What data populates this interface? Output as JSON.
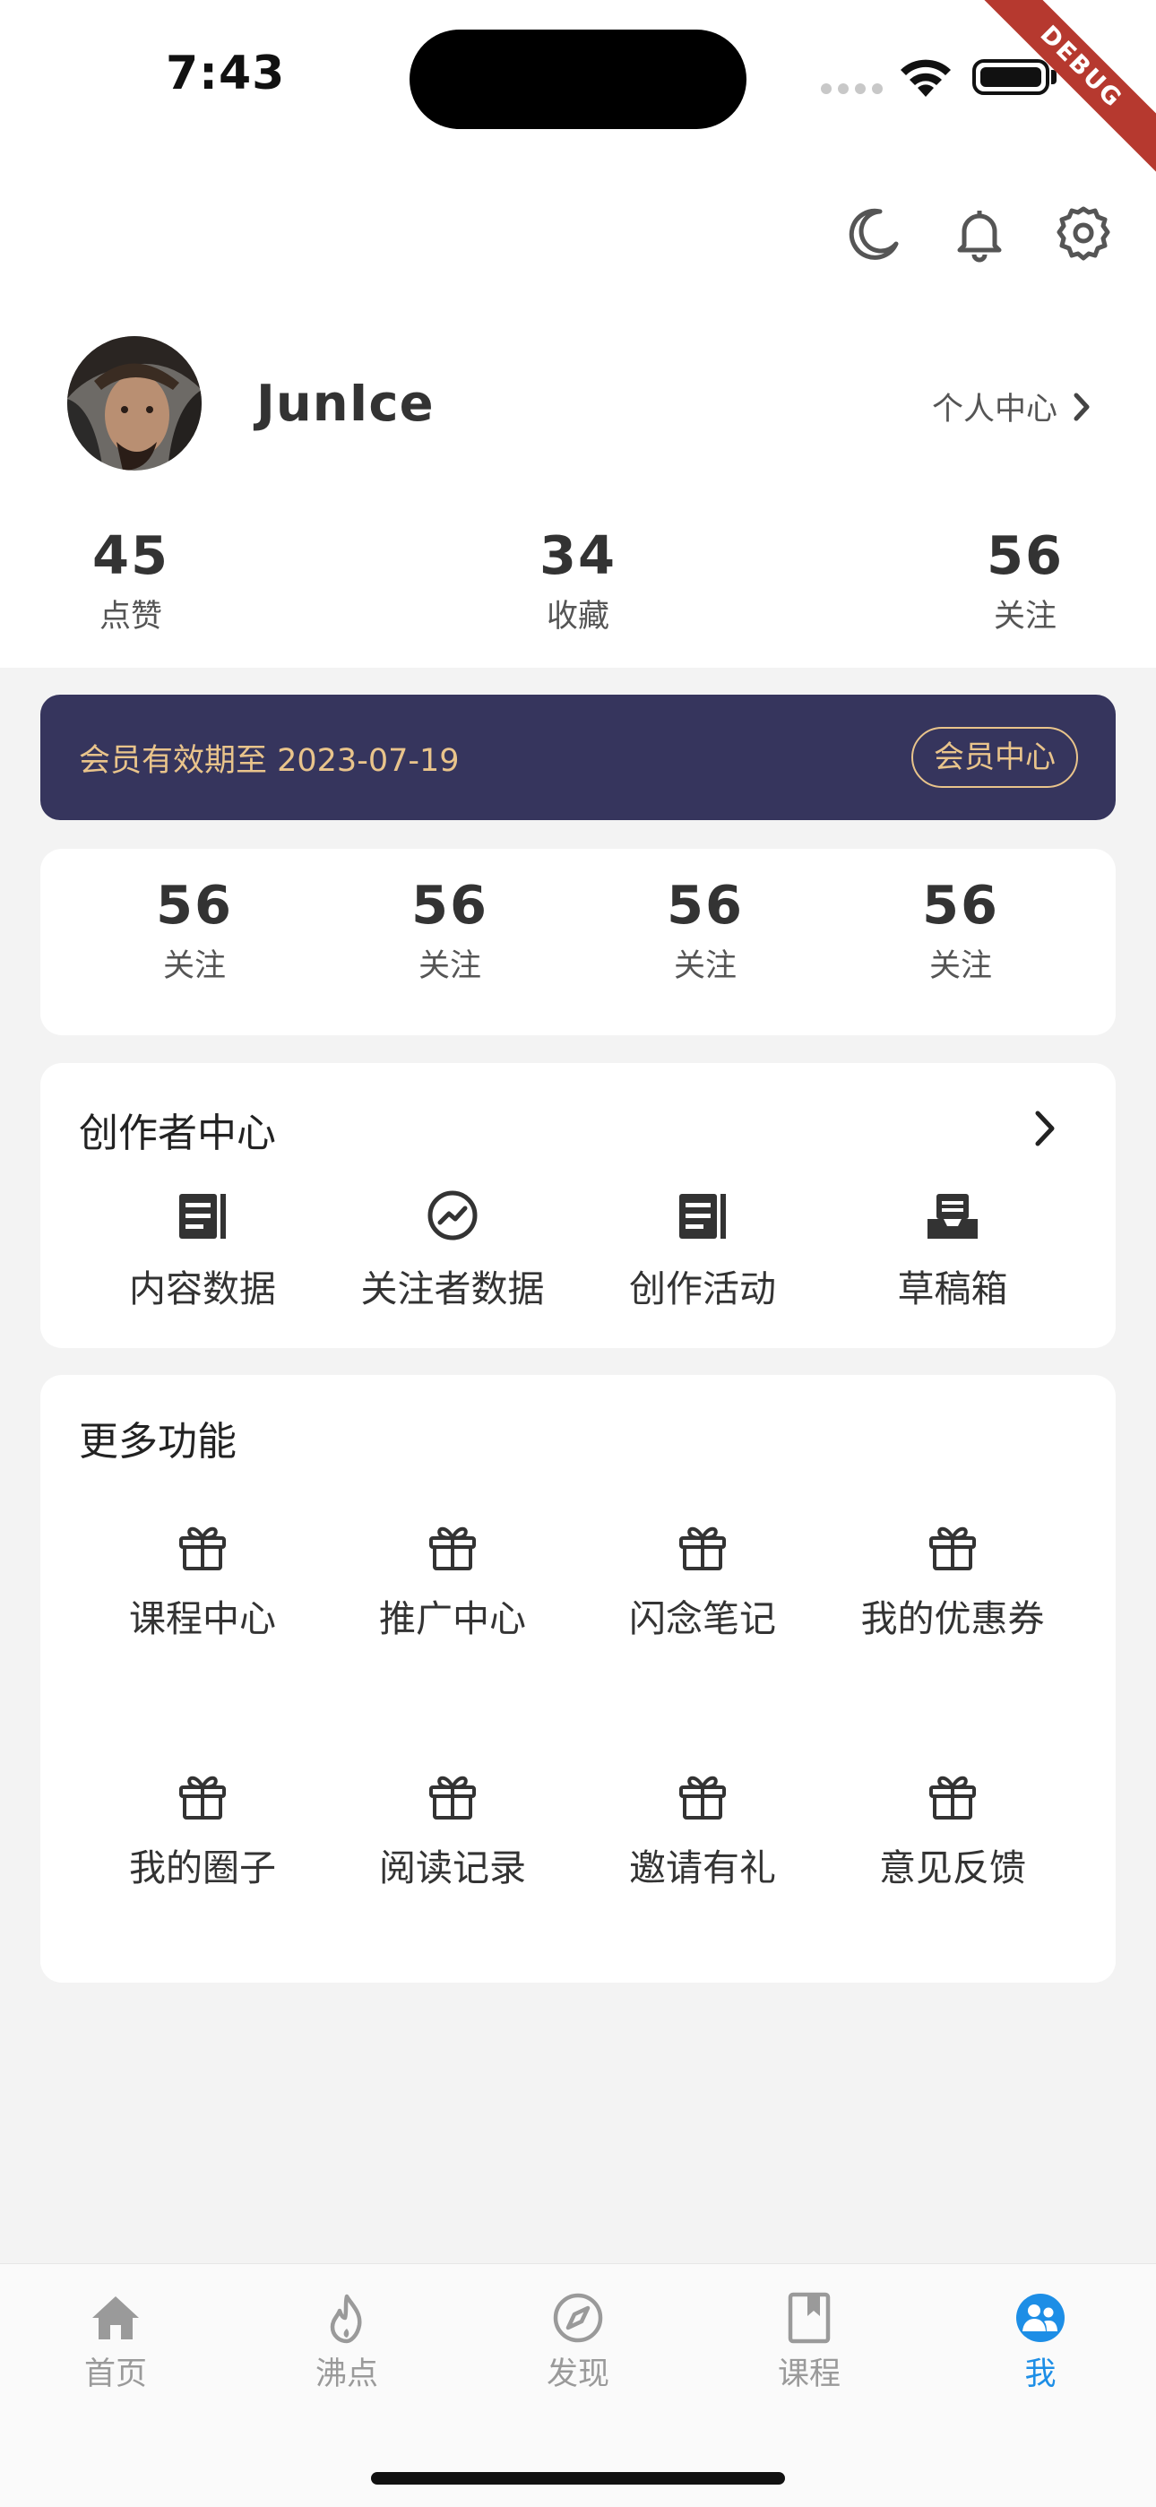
{
  "status_bar": {
    "time": "7:43",
    "debug_label": "DEBUG"
  },
  "header": {
    "icons": [
      "moon-icon",
      "bell-icon",
      "settings-icon"
    ]
  },
  "profile": {
    "username": "JunIce",
    "center_link": "个人中心",
    "stats": [
      {
        "value": "45",
        "label": "点赞"
      },
      {
        "value": "34",
        "label": "收藏"
      },
      {
        "value": "56",
        "label": "关注"
      }
    ]
  },
  "membership": {
    "text": "会员有效期至 2023-07-19",
    "button": "会员中心"
  },
  "quick_stats": [
    {
      "value": "56",
      "label": "关注"
    },
    {
      "value": "56",
      "label": "关注"
    },
    {
      "value": "56",
      "label": "关注"
    },
    {
      "value": "56",
      "label": "关注"
    }
  ],
  "creator_center": {
    "title": "创作者中心",
    "items": [
      {
        "label": "内容数据",
        "icon": "article-icon"
      },
      {
        "label": "关注者数据",
        "icon": "trend-icon"
      },
      {
        "label": "创作活动",
        "icon": "article-icon"
      },
      {
        "label": "草稿箱",
        "icon": "inbox-icon"
      }
    ]
  },
  "more_functions": {
    "title": "更多功能",
    "items": [
      {
        "label": "课程中心",
        "icon": "gift-icon"
      },
      {
        "label": "推广中心",
        "icon": "gift-icon"
      },
      {
        "label": "闪念笔记",
        "icon": "gift-icon"
      },
      {
        "label": "我的优惠券",
        "icon": "gift-icon"
      },
      {
        "label": "我的圈子",
        "icon": "gift-icon"
      },
      {
        "label": "阅读记录",
        "icon": "gift-icon"
      },
      {
        "label": "邀请有礼",
        "icon": "gift-icon"
      },
      {
        "label": "意见反馈",
        "icon": "gift-icon"
      }
    ]
  },
  "tabbar": {
    "active_index": 4,
    "active_color": "#1d8ee6",
    "inactive_color": "#9a9a9a",
    "tabs": [
      {
        "label": "首页",
        "icon": "home-icon"
      },
      {
        "label": "沸点",
        "icon": "flame-icon"
      },
      {
        "label": "发现",
        "icon": "compass-icon"
      },
      {
        "label": "课程",
        "icon": "book-icon"
      },
      {
        "label": "我",
        "icon": "profile-icon"
      }
    ]
  },
  "colors": {
    "vip_bg": "#36355d",
    "vip_gold": "#e9c48b",
    "page_bg": "#f3f3f3"
  }
}
